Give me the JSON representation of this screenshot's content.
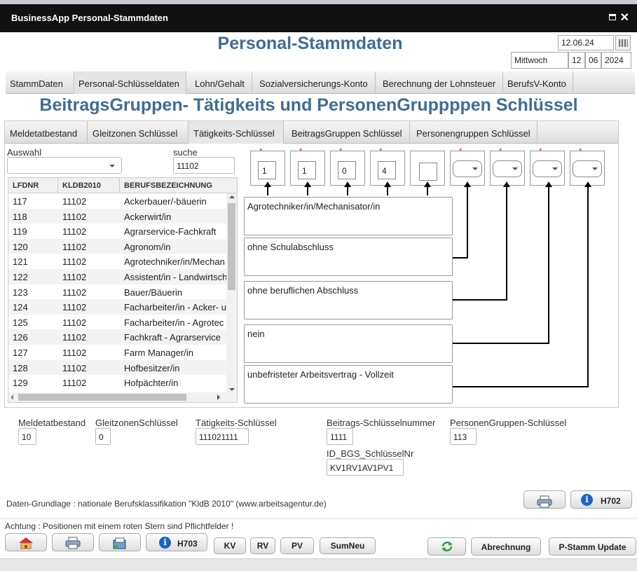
{
  "window": {
    "title": "BusinessApp Personal-Stammdaten"
  },
  "header": {
    "title": "Personal-Stammdaten",
    "date": "12.06.24",
    "weekday": "Mittwoch",
    "day": "12",
    "month": "06",
    "year": "2024"
  },
  "main_tabs": [
    "StammDaten",
    "Personal-Schlüsseldaten",
    "Lohn/Gehalt",
    "Sozialversicherungs-Konto",
    "Berechnung der Lohnsteuer",
    "BerufsV-Konto"
  ],
  "section_title": "BeitragsGruppen- Tätigkeits und PersonenGruppppen Schlüssel",
  "sub_tabs": [
    "Meldetatbestand",
    "Gleitzonen Schlüssel",
    "Tätigkeits-Schlüssel",
    "BeitragsGruppen Schlüssel",
    "Personengruppen Schlüssel"
  ],
  "filter": {
    "auswahl_label": "Auswahl",
    "auswahl_value": "",
    "suche_label": "suche",
    "suche_value": "11102"
  },
  "table": {
    "columns": [
      "LFDNR",
      "KLDB2010",
      "BERUFSBEZEICHNUNG"
    ],
    "rows": [
      [
        "117",
        "11102",
        "Ackerbauer/-bäuerin"
      ],
      [
        "118",
        "11102",
        "Ackerwirt/in"
      ],
      [
        "119",
        "11102",
        "Agrarservice-Fachkraft"
      ],
      [
        "120",
        "11102",
        "Agronom/in"
      ],
      [
        "121",
        "11102",
        "Agrotechniker/in/Mechan"
      ],
      [
        "122",
        "11102",
        "Assistent/in - Landwirtsch"
      ],
      [
        "123",
        "11102",
        "Bauer/Bäuerin"
      ],
      [
        "124",
        "11102",
        "Facharbeiter/in - Acker- u"
      ],
      [
        "125",
        "11102",
        "Facharbeiter/in - Agrotec"
      ],
      [
        "126",
        "11102",
        "Fachkraft - Agrarservice"
      ],
      [
        "127",
        "11102",
        "Farm Manager/in"
      ],
      [
        "128",
        "11102",
        "Hofbesitzer/in"
      ],
      [
        "129",
        "11102",
        "Hofpächter/in"
      ]
    ]
  },
  "key_fields": {
    "required_marker": "*",
    "digits": [
      "1",
      "1",
      "0",
      "4",
      ""
    ]
  },
  "descriptions": [
    "Agrotechniker/in/Mechanisator/in",
    "ohne Schulabschluss",
    "ohne beruflichen Abschluss",
    "nein",
    "unbefristeter Arbeitsvertrag - Vollzeit"
  ],
  "summary": {
    "meldetatbestand_label": "Meldetatbestand",
    "meldetatbestand_value": "10",
    "gleitzonen_label": "GleitzonenSchlüssel",
    "gleitzonen_value": "0",
    "taetigkeit_label": "Tätigkeits-Schlüssel",
    "taetigkeit_value": "111021111",
    "beitrag_label": "Beitrags-Schlüsselnummer",
    "beitrag_value": "1111",
    "personen_label": "PersonenGruppen-Schlüssel",
    "personen_value": "113",
    "id_bgs_label": "ID_BGS_SchlüsselNr",
    "id_bgs_value": "KV1RV1AV1PV1"
  },
  "source_note": "Daten-Grundlage : nationale Berufsklassifikation \"KldB 2010\" (www.arbeitsagentur.de)",
  "help_button_1": "H702",
  "warning": "Achtung : Positionen mit einem roten Stern sind Pflichtfelder !",
  "footer_buttons": {
    "h703": "H703",
    "kv": "KV",
    "rv": "RV",
    "pv": "PV",
    "sumneu": "SumNeu",
    "abrechnung": "Abrechnung",
    "pstamm": "P-Stamm Update"
  },
  "colors": {
    "title_blue": "#3f6d94",
    "titlebar": "#111111",
    "required_star": "#e02020",
    "info_blue": "#1d63c4"
  }
}
